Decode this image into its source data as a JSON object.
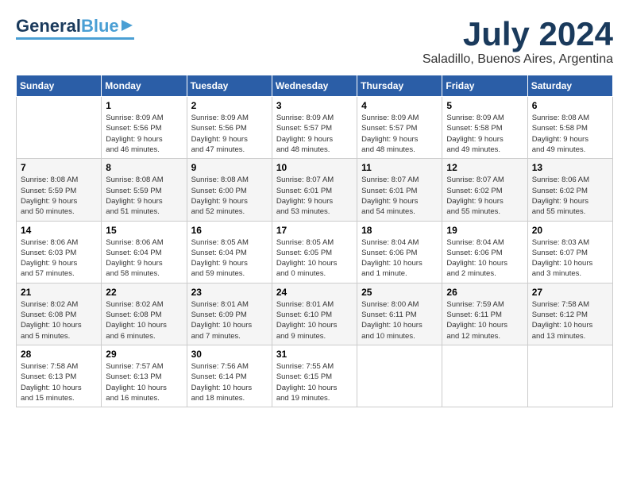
{
  "logo": {
    "general": "General",
    "blue": "Blue",
    "icon": "▶"
  },
  "title": {
    "month_year": "July 2024",
    "location": "Saladillo, Buenos Aires, Argentina"
  },
  "weekdays": [
    "Sunday",
    "Monday",
    "Tuesday",
    "Wednesday",
    "Thursday",
    "Friday",
    "Saturday"
  ],
  "weeks": [
    [
      {
        "day": "",
        "info": ""
      },
      {
        "day": "1",
        "info": "Sunrise: 8:09 AM\nSunset: 5:56 PM\nDaylight: 9 hours\nand 46 minutes."
      },
      {
        "day": "2",
        "info": "Sunrise: 8:09 AM\nSunset: 5:56 PM\nDaylight: 9 hours\nand 47 minutes."
      },
      {
        "day": "3",
        "info": "Sunrise: 8:09 AM\nSunset: 5:57 PM\nDaylight: 9 hours\nand 48 minutes."
      },
      {
        "day": "4",
        "info": "Sunrise: 8:09 AM\nSunset: 5:57 PM\nDaylight: 9 hours\nand 48 minutes."
      },
      {
        "day": "5",
        "info": "Sunrise: 8:09 AM\nSunset: 5:58 PM\nDaylight: 9 hours\nand 49 minutes."
      },
      {
        "day": "6",
        "info": "Sunrise: 8:08 AM\nSunset: 5:58 PM\nDaylight: 9 hours\nand 49 minutes."
      }
    ],
    [
      {
        "day": "7",
        "info": "Sunrise: 8:08 AM\nSunset: 5:59 PM\nDaylight: 9 hours\nand 50 minutes."
      },
      {
        "day": "8",
        "info": "Sunrise: 8:08 AM\nSunset: 5:59 PM\nDaylight: 9 hours\nand 51 minutes."
      },
      {
        "day": "9",
        "info": "Sunrise: 8:08 AM\nSunset: 6:00 PM\nDaylight: 9 hours\nand 52 minutes."
      },
      {
        "day": "10",
        "info": "Sunrise: 8:07 AM\nSunset: 6:01 PM\nDaylight: 9 hours\nand 53 minutes."
      },
      {
        "day": "11",
        "info": "Sunrise: 8:07 AM\nSunset: 6:01 PM\nDaylight: 9 hours\nand 54 minutes."
      },
      {
        "day": "12",
        "info": "Sunrise: 8:07 AM\nSunset: 6:02 PM\nDaylight: 9 hours\nand 55 minutes."
      },
      {
        "day": "13",
        "info": "Sunrise: 8:06 AM\nSunset: 6:02 PM\nDaylight: 9 hours\nand 55 minutes."
      }
    ],
    [
      {
        "day": "14",
        "info": "Sunrise: 8:06 AM\nSunset: 6:03 PM\nDaylight: 9 hours\nand 57 minutes."
      },
      {
        "day": "15",
        "info": "Sunrise: 8:06 AM\nSunset: 6:04 PM\nDaylight: 9 hours\nand 58 minutes."
      },
      {
        "day": "16",
        "info": "Sunrise: 8:05 AM\nSunset: 6:04 PM\nDaylight: 9 hours\nand 59 minutes."
      },
      {
        "day": "17",
        "info": "Sunrise: 8:05 AM\nSunset: 6:05 PM\nDaylight: 10 hours\nand 0 minutes."
      },
      {
        "day": "18",
        "info": "Sunrise: 8:04 AM\nSunset: 6:06 PM\nDaylight: 10 hours\nand 1 minute."
      },
      {
        "day": "19",
        "info": "Sunrise: 8:04 AM\nSunset: 6:06 PM\nDaylight: 10 hours\nand 2 minutes."
      },
      {
        "day": "20",
        "info": "Sunrise: 8:03 AM\nSunset: 6:07 PM\nDaylight: 10 hours\nand 3 minutes."
      }
    ],
    [
      {
        "day": "21",
        "info": "Sunrise: 8:02 AM\nSunset: 6:08 PM\nDaylight: 10 hours\nand 5 minutes."
      },
      {
        "day": "22",
        "info": "Sunrise: 8:02 AM\nSunset: 6:08 PM\nDaylight: 10 hours\nand 6 minutes."
      },
      {
        "day": "23",
        "info": "Sunrise: 8:01 AM\nSunset: 6:09 PM\nDaylight: 10 hours\nand 7 minutes."
      },
      {
        "day": "24",
        "info": "Sunrise: 8:01 AM\nSunset: 6:10 PM\nDaylight: 10 hours\nand 9 minutes."
      },
      {
        "day": "25",
        "info": "Sunrise: 8:00 AM\nSunset: 6:11 PM\nDaylight: 10 hours\nand 10 minutes."
      },
      {
        "day": "26",
        "info": "Sunrise: 7:59 AM\nSunset: 6:11 PM\nDaylight: 10 hours\nand 12 minutes."
      },
      {
        "day": "27",
        "info": "Sunrise: 7:58 AM\nSunset: 6:12 PM\nDaylight: 10 hours\nand 13 minutes."
      }
    ],
    [
      {
        "day": "28",
        "info": "Sunrise: 7:58 AM\nSunset: 6:13 PM\nDaylight: 10 hours\nand 15 minutes."
      },
      {
        "day": "29",
        "info": "Sunrise: 7:57 AM\nSunset: 6:13 PM\nDaylight: 10 hours\nand 16 minutes."
      },
      {
        "day": "30",
        "info": "Sunrise: 7:56 AM\nSunset: 6:14 PM\nDaylight: 10 hours\nand 18 minutes."
      },
      {
        "day": "31",
        "info": "Sunrise: 7:55 AM\nSunset: 6:15 PM\nDaylight: 10 hours\nand 19 minutes."
      },
      {
        "day": "",
        "info": ""
      },
      {
        "day": "",
        "info": ""
      },
      {
        "day": "",
        "info": ""
      }
    ]
  ]
}
